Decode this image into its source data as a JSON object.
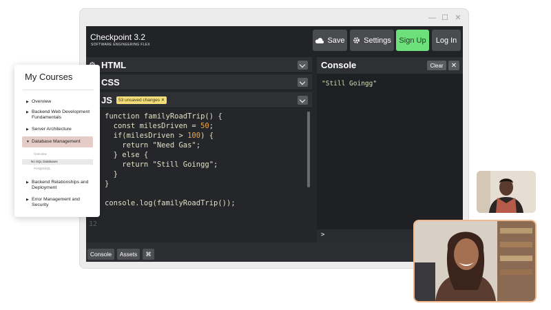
{
  "app": {
    "title": "Checkpoint 3.2",
    "subtitle": "SOFTWARE ENGINEERING FLEX",
    "buttons": {
      "save": "Save",
      "settings": "Settings",
      "signup": "Sign Up",
      "login": "Log In"
    },
    "accent_signup": "#6ee07b"
  },
  "panels": {
    "html": "HTML",
    "css": "CSS",
    "js": "JS",
    "unsaved_badge": "53 unsaved changes"
  },
  "code": {
    "line_numbers": [
      "12"
    ],
    "lines": [
      "function familyRoadTrip() {",
      "  const milesDriven = 50;",
      "  if(milesDriven > 100) {",
      "    return \"Need Gas\";",
      "  } else {",
      "    return \"Still Goingg\";",
      "  }",
      "}",
      "",
      "console.log(familyRoadTrip());"
    ]
  },
  "console": {
    "title": "Console",
    "clear": "Clear",
    "close": "✕",
    "output": "\"Still Goingg\"",
    "prompt": ">"
  },
  "footer": {
    "console": "Console",
    "assets": "Assets",
    "shortcut": "⌘"
  },
  "courses": {
    "title": "My Courses",
    "items": [
      {
        "label": "Overview"
      },
      {
        "label": "Backend Web Development Fundamentals"
      },
      {
        "label": "Server Architecture"
      },
      {
        "label": "Database Management"
      },
      {
        "label": "Backend Relationships and Deployment"
      },
      {
        "label": "Error Management and Security"
      }
    ],
    "subitems": [
      "Overview",
      "No SQL Databases",
      "PostgreSQL"
    ]
  }
}
